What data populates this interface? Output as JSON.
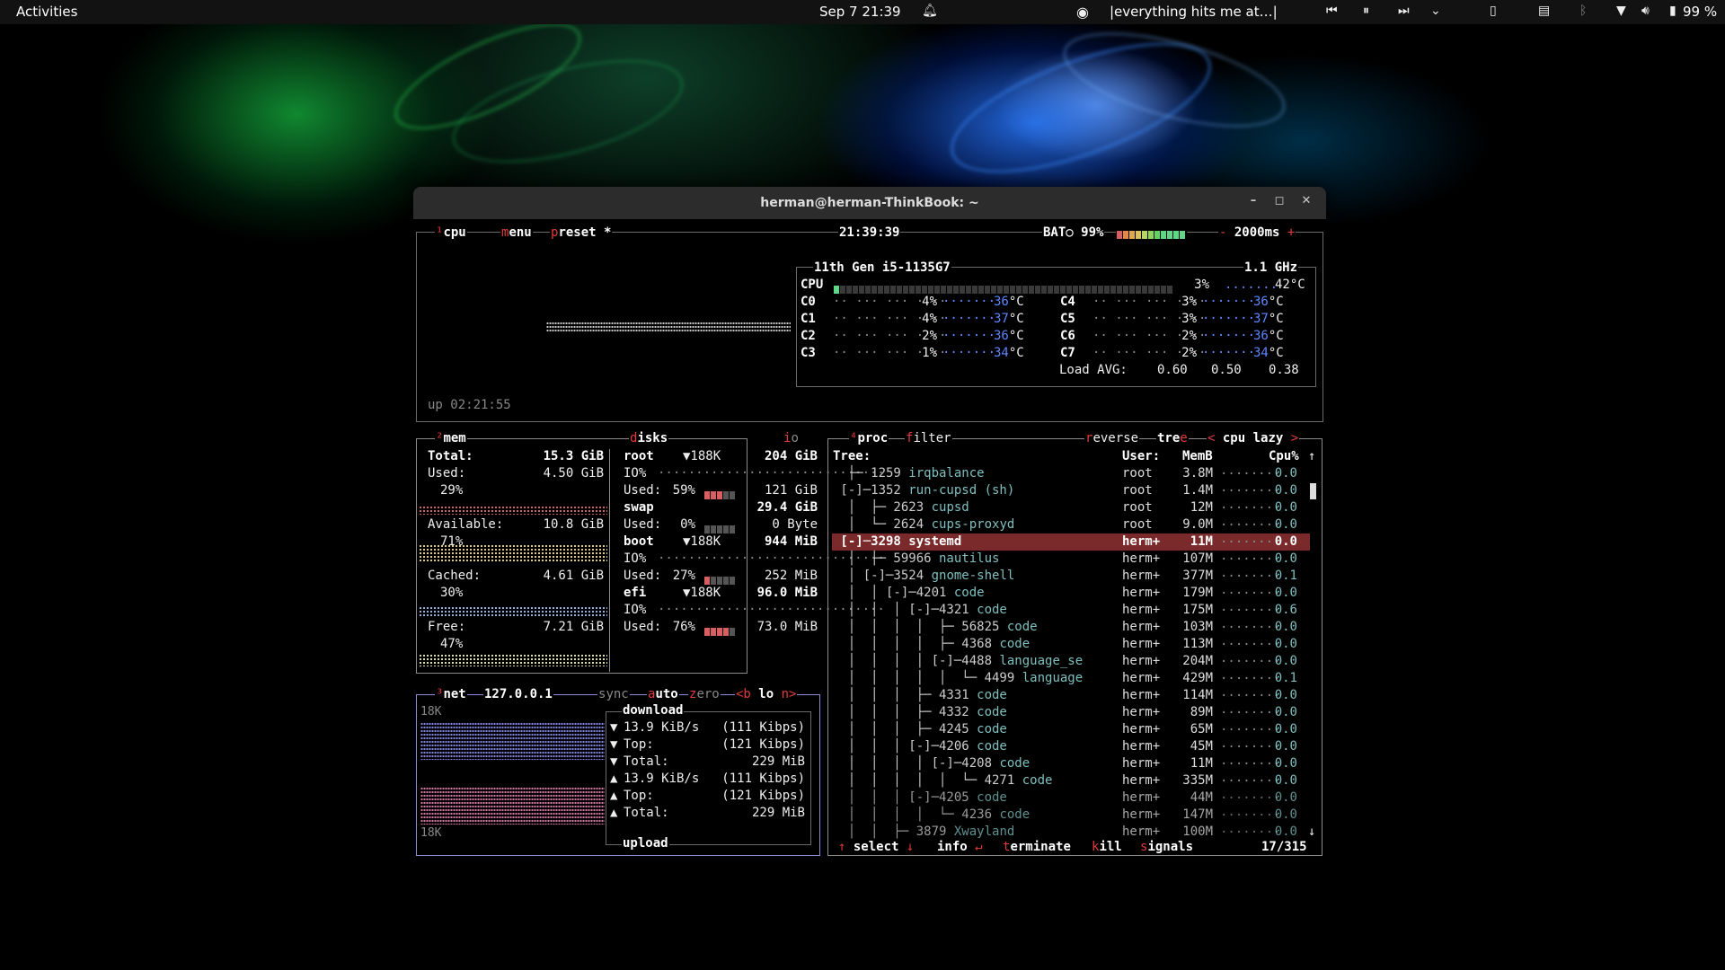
{
  "topbar": {
    "activities": "Activities",
    "clock": "Sep 7  21:39",
    "media_title": "|everything hits me at…|",
    "battery": "99 %"
  },
  "window": {
    "title": "herman@herman-ThinkBook: ~"
  },
  "cpu": {
    "tab_cpu": "cpu",
    "tab_menu": "menu",
    "tab_preset": "preset *",
    "clock": "21:39:39",
    "battery_label": "BAT○ 99%",
    "interval": "2000ms",
    "interval_minus": "-",
    "interval_plus": "+",
    "model": "11th Gen i5-1135G7",
    "freq": "1.1 GHz",
    "total_label": "CPU",
    "total_pct": "3%",
    "total_temp": "42°C",
    "cores": [
      {
        "name": "C0",
        "pct": "4%",
        "temp": "36°C"
      },
      {
        "name": "C1",
        "pct": "4%",
        "temp": "37°C"
      },
      {
        "name": "C2",
        "pct": "2%",
        "temp": "36°C"
      },
      {
        "name": "C3",
        "pct": "1%",
        "temp": "34°C"
      },
      {
        "name": "C4",
        "pct": "3%",
        "temp": "36°C"
      },
      {
        "name": "C5",
        "pct": "3%",
        "temp": "37°C"
      },
      {
        "name": "C6",
        "pct": "2%",
        "temp": "36°C"
      },
      {
        "name": "C7",
        "pct": "2%",
        "temp": "34°C"
      }
    ],
    "load_avg_label": "Load AVG:",
    "load_avg": [
      "0.60",
      "0.50",
      "0.38"
    ],
    "uptime": "up 02:21:55"
  },
  "mem": {
    "title": "mem",
    "total_label": "Total:",
    "total": "15.3 GiB",
    "used_label": "Used:",
    "used": "4.50 GiB",
    "used_pct": "29%",
    "available_label": "Available:",
    "available": "10.8 GiB",
    "available_pct": "71%",
    "cached_label": "Cached:",
    "cached": "4.61 GiB",
    "cached_pct": "30%",
    "free_label": "Free:",
    "free": "7.21 GiB",
    "free_pct": "47%"
  },
  "disks": {
    "title": "disks",
    "io_tab": "io",
    "items": [
      {
        "name": "root",
        "io_rate": "▼188K",
        "size": "204 GiB",
        "io": "IO%",
        "used_label": "Used:",
        "used_pct": "59%",
        "used": "121 GiB"
      },
      {
        "name": "swap",
        "io_rate": "",
        "size": "29.4 GiB",
        "io": "",
        "used_label": "Used:",
        "used_pct": "0%",
        "used": "0 Byte"
      },
      {
        "name": "boot",
        "io_rate": "▼188K",
        "size": "944 MiB",
        "io": "IO%",
        "used_label": "Used:",
        "used_pct": "27%",
        "used": "252 MiB"
      },
      {
        "name": "efi",
        "io_rate": "▼188K",
        "size": "96.0 MiB",
        "io": "IO%",
        "used_label": "Used:",
        "used_pct": "76%",
        "used": "73.0 MiB"
      }
    ]
  },
  "net": {
    "title": "net",
    "iface": "127.0.0.1",
    "sync": "sync",
    "auto": "auto",
    "zero": "zero",
    "prev": "<b",
    "iface_short": "lo",
    "next": "n>",
    "scale_top": "18K",
    "scale_bottom": "18K",
    "download_label": "download",
    "upload_label": "upload",
    "rows": [
      {
        "arrow": "▼",
        "label": "13.9 KiB/s",
        "value": "(111 Kibps)"
      },
      {
        "arrow": "▼",
        "label": "Top:",
        "value": "(121 Kibps)"
      },
      {
        "arrow": "▼",
        "label": "Total:",
        "value": "229 MiB"
      },
      {
        "arrow": "▲",
        "label": "13.9 KiB/s",
        "value": "(111 Kibps)"
      },
      {
        "arrow": "▲",
        "label": "Top:",
        "value": "(121 Kibps)"
      },
      {
        "arrow": "▲",
        "label": "Total:",
        "value": "229 MiB"
      }
    ]
  },
  "proc": {
    "title": "proc",
    "filter": "filter",
    "reverse": "reverse",
    "tree": "tree",
    "sort_prev": "<",
    "sort": "cpu lazy",
    "sort_next": ">",
    "hdr_tree": "Tree:",
    "hdr_user": "User:",
    "hdr_mem": "MemB",
    "hdr_cpu": "Cpu%",
    "rows": [
      {
        "tree": "  ├─ 1259 irqbalance",
        "user": "root",
        "mem": "3.8M",
        "cpu": "0.0"
      },
      {
        "tree": " [-]─1352 run-cupsd (sh)",
        "user": "root",
        "mem": "1.4M",
        "cpu": "0.0"
      },
      {
        "tree": "  │  ├─ 2623 cupsd",
        "user": "root",
        "mem": "12M",
        "cpu": "0.0"
      },
      {
        "tree": "  │  └─ 2624 cups-proxyd",
        "user": "root",
        "mem": "9.0M",
        "cpu": "0.0"
      },
      {
        "tree": " [-]─3298 systemd",
        "user": "herm+",
        "mem": "11M",
        "cpu": "0.0"
      },
      {
        "tree": "  │  ├─ 59966 nautilus",
        "user": "herm+",
        "mem": "107M",
        "cpu": "0.0"
      },
      {
        "tree": "  │ [-]─3524 gnome-shell",
        "user": "herm+",
        "mem": "377M",
        "cpu": "0.1"
      },
      {
        "tree": "  │  │ [-]─4201 code",
        "user": "herm+",
        "mem": "179M",
        "cpu": "0.0"
      },
      {
        "tree": "  │  │  │ [-]─4321 code",
        "user": "herm+",
        "mem": "175M",
        "cpu": "0.6"
      },
      {
        "tree": "  │  │  │  │  ├─ 56825 code",
        "user": "herm+",
        "mem": "103M",
        "cpu": "0.0"
      },
      {
        "tree": "  │  │  │  │  ├─ 4368 code",
        "user": "herm+",
        "mem": "113M",
        "cpu": "0.0"
      },
      {
        "tree": "  │  │  │  │ [-]─4488 language_se",
        "user": "herm+",
        "mem": "204M",
        "cpu": "0.0"
      },
      {
        "tree": "  │  │  │  │  │  └─ 4499 language",
        "user": "herm+",
        "mem": "429M",
        "cpu": "0.1"
      },
      {
        "tree": "  │  │  │  ├─ 4331 code",
        "user": "herm+",
        "mem": "114M",
        "cpu": "0.0"
      },
      {
        "tree": "  │  │  │  ├─ 4332 code",
        "user": "herm+",
        "mem": "89M",
        "cpu": "0.0"
      },
      {
        "tree": "  │  │  │  ├─ 4245 code",
        "user": "herm+",
        "mem": "65M",
        "cpu": "0.0"
      },
      {
        "tree": "  │  │  │ [-]─4206 code",
        "user": "herm+",
        "mem": "45M",
        "cpu": "0.0"
      },
      {
        "tree": "  │  │  │  │ [-]─4208 code",
        "user": "herm+",
        "mem": "11M",
        "cpu": "0.0"
      },
      {
        "tree": "  │  │  │  │  │  └─ 4271 code",
        "user": "herm+",
        "mem": "335M",
        "cpu": "0.0"
      },
      {
        "tree": "  │  │  │ [-]─4205 code",
        "user": "herm+",
        "mem": "44M",
        "cpu": "0.0"
      },
      {
        "tree": "  │  │  │  │  └─ 4236 code",
        "user": "herm+",
        "mem": "147M",
        "cpu": "0.0"
      },
      {
        "tree": "  │  │  ├─ 3879 Xwayland",
        "user": "herm+",
        "mem": "100M",
        "cpu": "0.0"
      }
    ],
    "selected_index": 4,
    "footer_select": "select",
    "footer_info": "info",
    "footer_terminate": "terminate",
    "footer_kill": "kill",
    "footer_signals": "signals",
    "count": "17/315"
  },
  "colors": {
    "accent_red": "#e03c3c",
    "temp_blue": "#5f87ff",
    "proc_cyan": "#7fbfbf",
    "selection": "#7a2a2a"
  }
}
